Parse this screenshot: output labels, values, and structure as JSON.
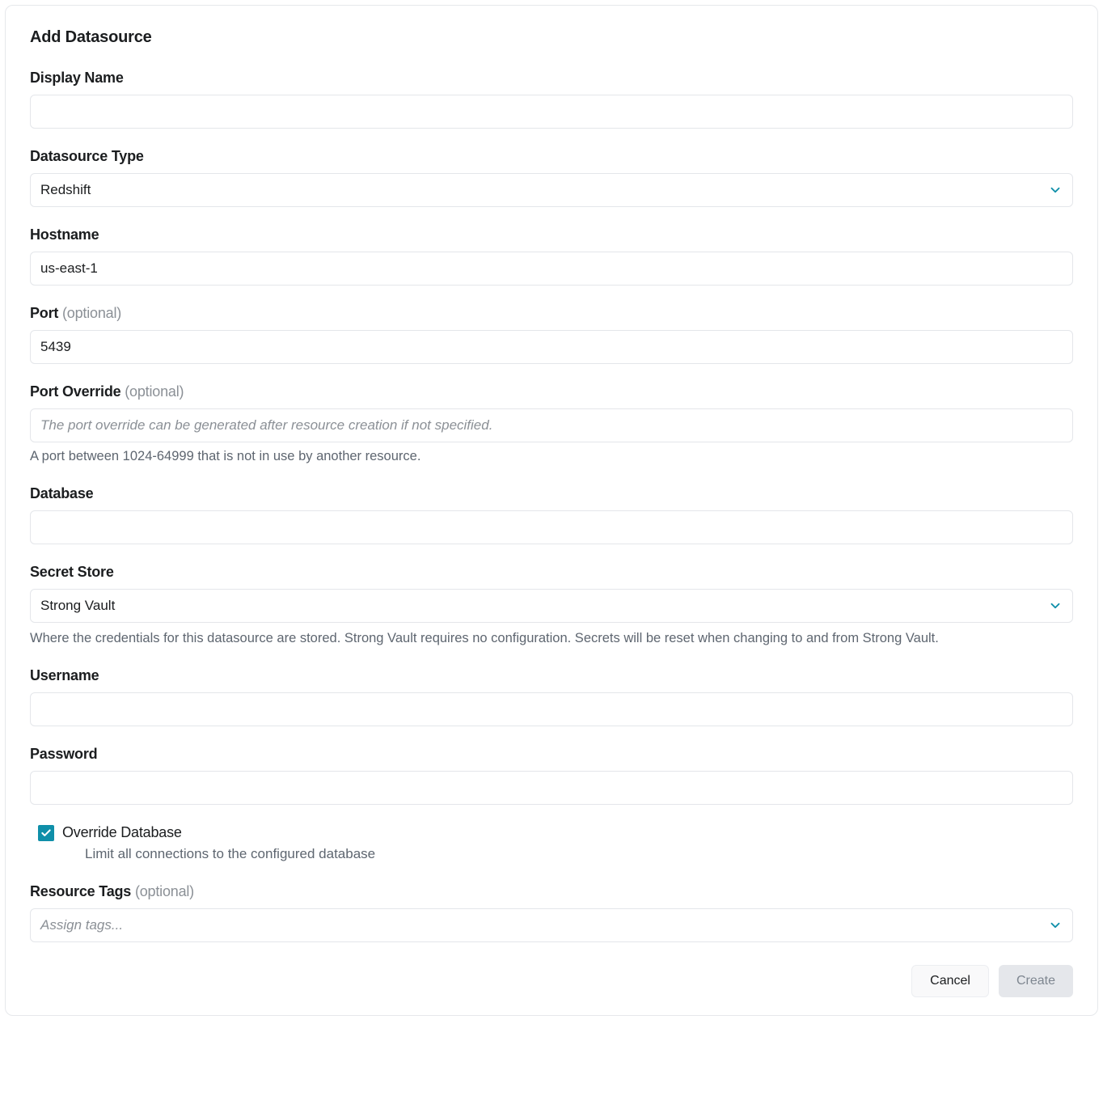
{
  "title": "Add Datasource",
  "fields": {
    "displayName": {
      "label": "Display Name",
      "value": ""
    },
    "datasourceType": {
      "label": "Datasource Type",
      "value": "Redshift"
    },
    "hostname": {
      "label": "Hostname",
      "value": "us-east-1"
    },
    "port": {
      "label": "Port",
      "optional": "(optional)",
      "value": "5439"
    },
    "portOverride": {
      "label": "Port Override",
      "optional": "(optional)",
      "value": "",
      "placeholder": "The port override can be generated after resource creation if not specified.",
      "helper": "A port between 1024-64999 that is not in use by another resource."
    },
    "database": {
      "label": "Database",
      "value": ""
    },
    "secretStore": {
      "label": "Secret Store",
      "value": "Strong Vault",
      "helper": "Where the credentials for this datasource are stored. Strong Vault requires no configuration. Secrets will be reset when changing to and from Strong Vault."
    },
    "username": {
      "label": "Username",
      "value": ""
    },
    "password": {
      "label": "Password",
      "value": ""
    },
    "overrideDatabase": {
      "checked": true,
      "label": "Override Database",
      "sub": "Limit all connections to the configured database"
    },
    "resourceTags": {
      "label": "Resource Tags",
      "optional": "(optional)",
      "placeholder": "Assign tags..."
    }
  },
  "buttons": {
    "cancel": "Cancel",
    "create": "Create"
  },
  "colors": {
    "accent": "#0f8fa9"
  }
}
